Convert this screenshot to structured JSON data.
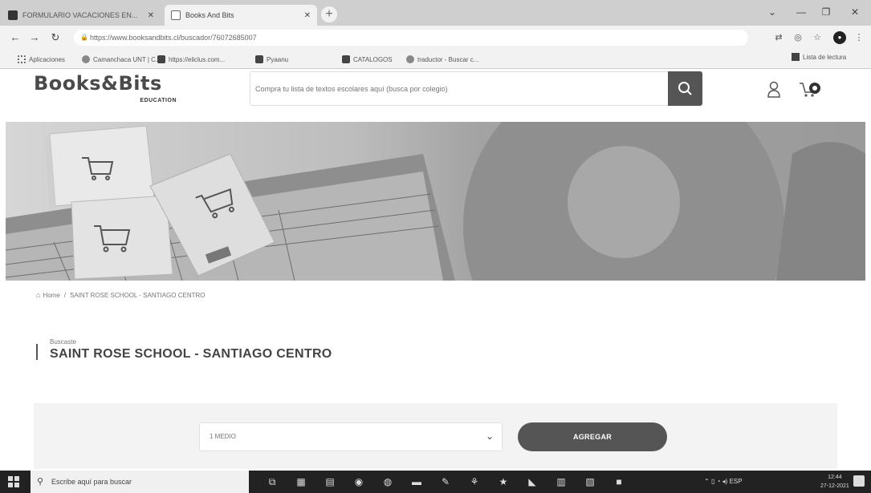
{
  "browser": {
    "tabs": [
      {
        "label": "FORMULARIO VACACIONES EN..."
      },
      {
        "label": "Books And Bits"
      }
    ],
    "new_tab": "+",
    "url": "https://www.booksandbits.cl/buscador/76072685007",
    "bookmarks": [
      {
        "label": "Aplicaciones"
      },
      {
        "label": "Camanchaca UNT | C..."
      },
      {
        "label": "https://eliclus.com..."
      },
      {
        "label": "Pyaanu"
      },
      {
        "label": "CATALOGOS"
      },
      {
        "label": "traductor - Buscar c..."
      }
    ],
    "reading_list": "Lista de lectura"
  },
  "site": {
    "brand_word": "Books&Bits",
    "brand_sub": "EDUCATION",
    "search_placeholder": "Compra tu lista de textos escolares aquí (busca por colegio)"
  },
  "breadcrumb": {
    "home": "Home",
    "separator": "/",
    "current": "SAINT ROSE SCHOOL - SANTIAGO CENTRO"
  },
  "results": {
    "searched_label": "Buscaste",
    "title": "SAINT ROSE SCHOOL - SANTIAGO CENTRO"
  },
  "filter": {
    "grade_selected": "1 MEDIO",
    "add_label": "AGREGAR"
  },
  "taskbar": {
    "search_placeholder": "Escribe aquí para buscar",
    "tray_lang": "ESP",
    "time": "12:44",
    "date": "27-12-2021"
  }
}
